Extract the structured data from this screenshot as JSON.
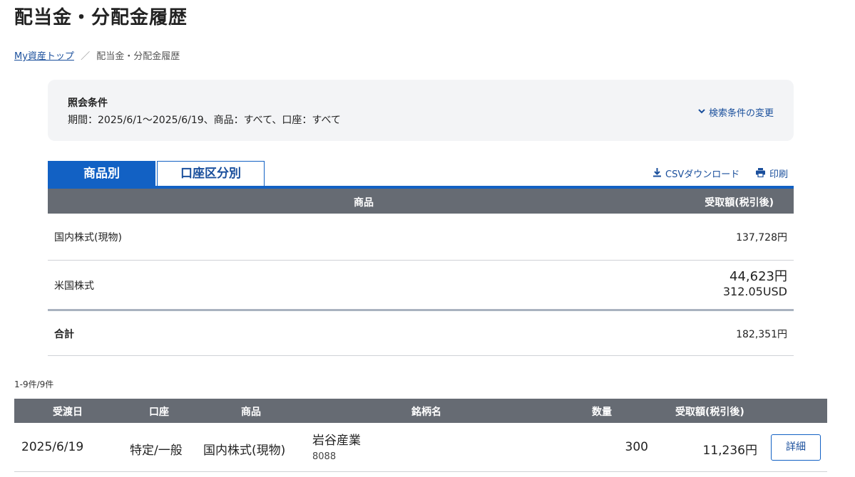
{
  "page": {
    "title": "配当金・分配金履歴"
  },
  "breadcrumb": {
    "home_label": "My資産トップ",
    "separator": "／",
    "current": "配当金・分配金履歴"
  },
  "conditions": {
    "title": "照会条件",
    "text": "期間：2025/6/1〜2025/6/19、商品：すべて、口座：すべて",
    "change_label": "検索条件の変更",
    "change_icon": "chevron-down-icon"
  },
  "tabs": [
    {
      "label": "商品別",
      "active": true
    },
    {
      "label": "口座区分別",
      "active": false
    }
  ],
  "toolbar": {
    "csv_label": "CSVダウンロード",
    "csv_icon": "download-icon",
    "print_label": "印刷",
    "print_icon": "printer-icon"
  },
  "summary": {
    "headers": {
      "product": "商品",
      "amount": "受取額(税引後)"
    },
    "rows": [
      {
        "product": "国内株式(現物)",
        "amount": "137,728円"
      },
      {
        "product": "米国株式",
        "amount": "44,623円",
        "amount_sub": "312.05USD"
      }
    ],
    "total": {
      "label": "合計",
      "amount": "182,351円"
    }
  },
  "list": {
    "count": "1-9件/9件",
    "headers": {
      "date": "受渡日",
      "account": "口座",
      "product": "商品",
      "issue": "銘柄名",
      "quantity": "数量",
      "amount": "受取額(税引後)"
    },
    "rows": [
      {
        "date": "2025/6/19",
        "account": "特定/一般",
        "product": "国内株式(現物)",
        "issue_name": "岩谷産業",
        "issue_code": "8088",
        "quantity": "300",
        "amount": "11,236円",
        "detail_label": "詳細"
      }
    ]
  },
  "colors": {
    "accent": "#1261c4",
    "link": "#1a4f9c",
    "header_bg": "#666b73",
    "panel_bg": "#f3f4f6"
  }
}
